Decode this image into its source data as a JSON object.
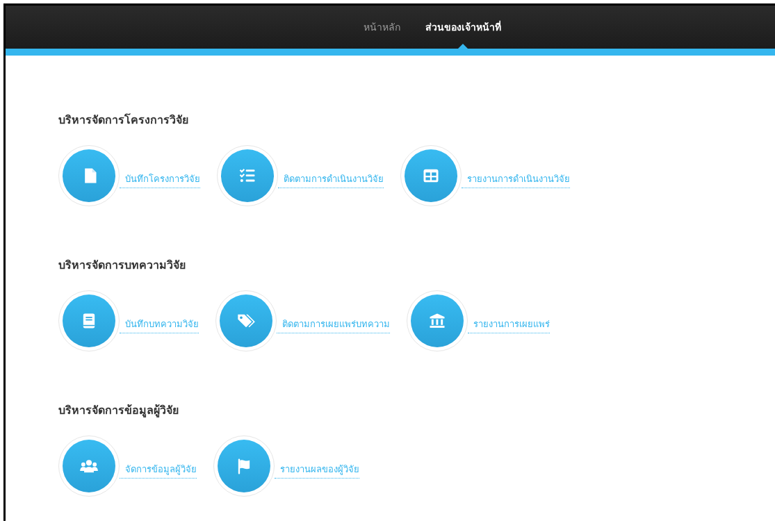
{
  "nav": [
    {
      "label": "หน้าหลัก",
      "selected": false
    },
    {
      "label": "ส่วนของเจ้าหน้าที่",
      "selected": true
    }
  ],
  "sections": [
    {
      "title": "บริหารจัดการโครงการวิจัย",
      "items": [
        {
          "label": "บันทึกโครงการวิจัย"
        },
        {
          "label": "ติดตามการดำเนินงานวิจัย"
        },
        {
          "label": "รายงานการดำเนินงานวิจัย"
        }
      ]
    },
    {
      "title": "บริหารจัดการบทความวิจัย",
      "items": [
        {
          "label": "บันทึกบทความวิจัย"
        },
        {
          "label": "ติดตามการเผยแพร่บทความ"
        },
        {
          "label": "รายงานการเผยแพร่"
        }
      ]
    },
    {
      "title": "บริหารจัดการข้อมูลผู้วิจัย",
      "items": [
        {
          "label": "จัดการข้อมูลผู้วิจัย"
        },
        {
          "label": "รายงานผลของผู้วิจัย"
        }
      ]
    }
  ]
}
